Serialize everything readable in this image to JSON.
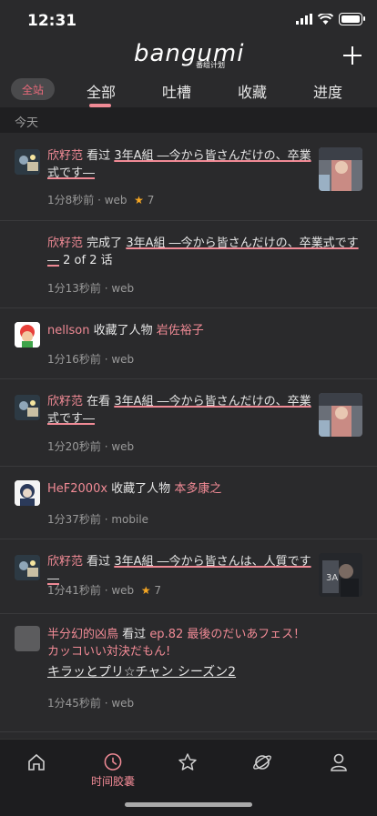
{
  "status_bar": {
    "time": "12:31"
  },
  "header": {
    "logo": "bangumi",
    "logo_sub": "番组计划"
  },
  "tabs": {
    "pill": "全站",
    "items": [
      {
        "label": "全部"
      },
      {
        "label": "吐槽"
      },
      {
        "label": "收藏"
      },
      {
        "label": "进度"
      }
    ]
  },
  "section_title": "今天",
  "feed": [
    {
      "user": "欣籽范",
      "action": "看过",
      "subject": "3年A組 ―今から皆さんだけの、卒業式です―",
      "meta": "1分8秒前 · web",
      "rating": "7"
    },
    {
      "user": "欣籽范",
      "action": "完成了",
      "subject": "3年A組 ―今から皆さんだけの、卒業式です―",
      "suffix": "2 of 2 话",
      "meta": "1分13秒前 · web"
    },
    {
      "user": "nellson",
      "action": "收藏了人物",
      "subject": "岩佐裕子",
      "meta": "1分16秒前 · web"
    },
    {
      "user": "欣籽范",
      "action": "在看",
      "subject": "3年A組 ―今から皆さんだけの、卒業式です―",
      "meta": "1分20秒前 · web"
    },
    {
      "user": "HeF2000x",
      "action": "收藏了人物",
      "subject": "本多康之",
      "meta": "1分37秒前 · mobile"
    },
    {
      "user": "欣籽范",
      "action": "看过",
      "subject": "3年A組 ―今から皆さんは、人質です―",
      "meta": "1分41秒前 · web",
      "rating": "7"
    },
    {
      "user": "半分幻的凶鳥",
      "action": "看过",
      "subject": "ep.82 最後のだいあフェス！ カッコいい対決だもん!",
      "extra": "キラッとプリ☆チャン シーズン2",
      "meta": "1分45秒前 · web"
    }
  ],
  "bottom_nav": {
    "active_label": "时间胶囊"
  },
  "colors": {
    "accent": "#f08a95",
    "background": "#2a2a2c",
    "star": "#f5a623"
  }
}
